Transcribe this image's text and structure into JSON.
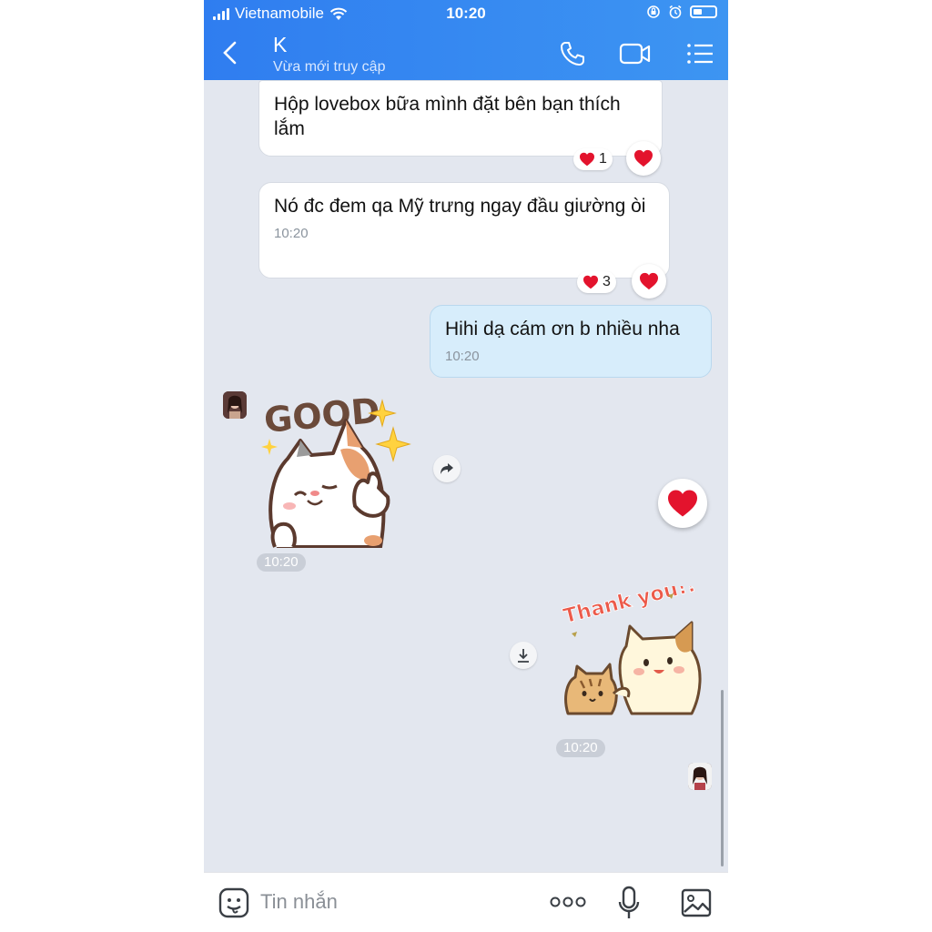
{
  "status_bar": {
    "carrier": "Vietnamobile",
    "time": "10:20"
  },
  "header": {
    "contact_name": "K",
    "contact_status": "Vừa mới truy cập"
  },
  "messages": [
    {
      "sender": "them",
      "text": "Hộp lovebox bữa mình đặt bên bạn thích lắm",
      "reaction_count": "1"
    },
    {
      "sender": "them",
      "text": "Nó đc đem qa Mỹ trưng ngay đầu giường òi",
      "time": "10:20",
      "reaction_count": "3"
    },
    {
      "sender": "me",
      "text": "Hihi dạ cám ơn b nhiều nha",
      "time": "10:20"
    },
    {
      "sender": "them",
      "sticker": "good-cat-sticker",
      "sticker_text": "GOOD",
      "time": "10:20"
    },
    {
      "sender": "me",
      "sticker": "thank-you-cats-sticker",
      "sticker_text": "Thank you!!",
      "time": "10:20"
    }
  ],
  "composer": {
    "placeholder": "Tin nhắn"
  },
  "colors": {
    "header": "#3389f1",
    "background": "#e3e7ef",
    "my_bubble": "#d7edfb",
    "heart": "#e3132d"
  }
}
